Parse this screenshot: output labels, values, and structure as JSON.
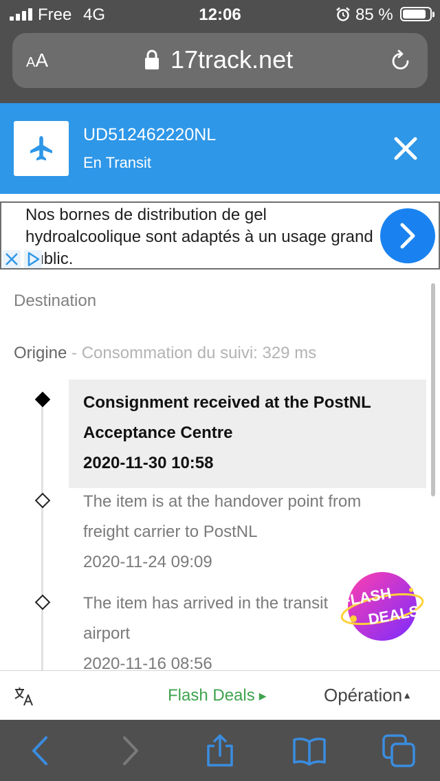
{
  "status_bar": {
    "carrier": "Free",
    "network": "4G",
    "time": "12:06",
    "battery_percent": "85 %",
    "battery_level": 0.85,
    "icons": [
      "signal-icon",
      "alarm-icon",
      "battery-icon"
    ]
  },
  "browser": {
    "text_size_small": "A",
    "text_size_large": "A",
    "url": "17track.net",
    "icons": [
      "lock-icon",
      "reload-icon"
    ]
  },
  "tracking": {
    "number": "UD512462220NL",
    "status": "En Transit",
    "icons": [
      "airplane-icon",
      "close-icon"
    ],
    "header_color": "#2e97e8"
  },
  "ad": {
    "text": "Nos bornes de distribution de gel hydroalcoolique sont adaptés à un usage grand public.",
    "icons": [
      "chevron-right-icon",
      "ad-close-icon",
      "ad-choices-icon"
    ],
    "button_color": "#1a82f0"
  },
  "details": {
    "destination_label": "Destination",
    "origin_label": "Origine",
    "origin_separator": " - ",
    "origin_metric": "Consommation du suivi: 329 ms"
  },
  "events": [
    {
      "line1": "Consignment received at the PostNL",
      "line2": "Acceptance Centre",
      "datetime": "2020-11-30 10:58"
    },
    {
      "line1": "The item is at the handover point from",
      "line2": "freight carrier to PostNL",
      "datetime": "2020-11-24 09:09"
    },
    {
      "line1": "The item has arrived in the transit",
      "line2": "airport",
      "datetime": "2020-11-16 08:56"
    }
  ],
  "flash_badge": {
    "line1": "FLASH",
    "line2": "DEALS"
  },
  "page_toolbar": {
    "flash_deals": "Flash Deals",
    "operation": "Opération",
    "flash_color": "#3fa34d",
    "icons": [
      "translate-icon"
    ]
  },
  "safari_toolbar": {
    "icons": [
      "back-icon",
      "forward-icon",
      "share-icon",
      "bookmarks-icon",
      "tabs-icon"
    ],
    "accent": "#3a8de0"
  }
}
